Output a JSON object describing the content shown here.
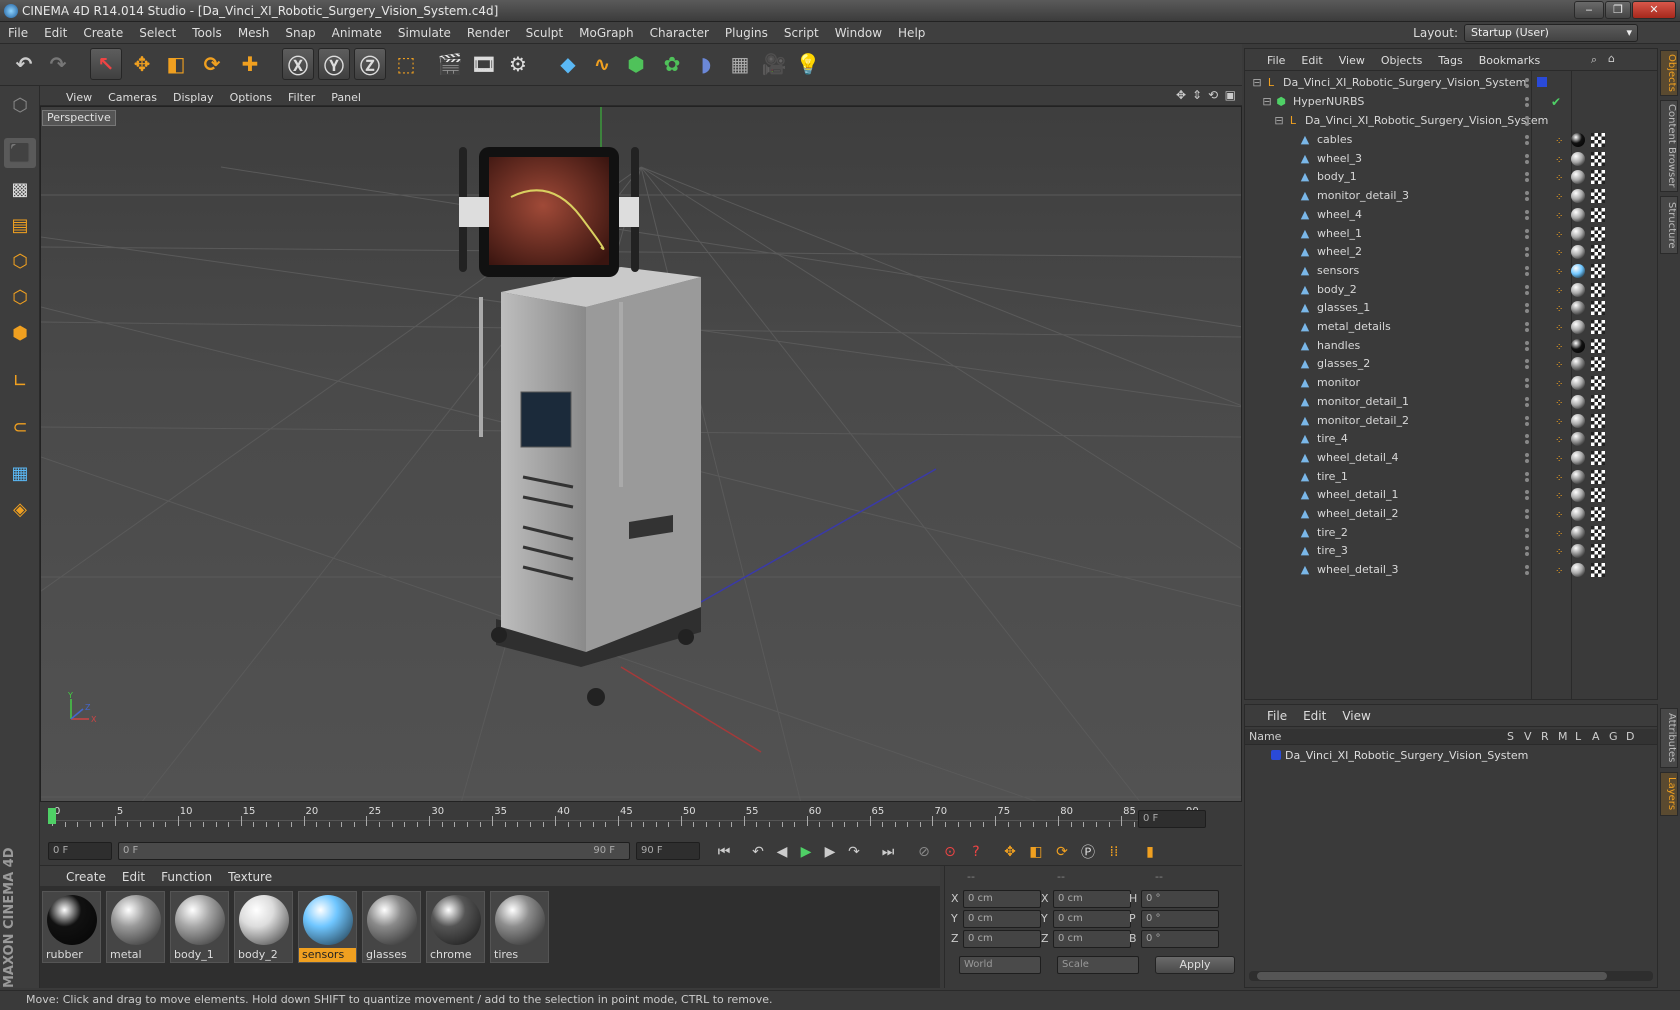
{
  "window": {
    "title": "CINEMA 4D R14.014 Studio - [Da_Vinci_XI_Robotic_Surgery_Vision_System.c4d]"
  },
  "menubar": {
    "items": [
      "File",
      "Edit",
      "Create",
      "Select",
      "Tools",
      "Mesh",
      "Snap",
      "Animate",
      "Simulate",
      "Render",
      "Sculpt",
      "MoGraph",
      "Character",
      "Plugins",
      "Script",
      "Window",
      "Help"
    ],
    "layout_label": "Layout:",
    "layout_value": "Startup (User)"
  },
  "viewport": {
    "menu": [
      "View",
      "Cameras",
      "Display",
      "Options",
      "Filter",
      "Panel"
    ],
    "label": "Perspective"
  },
  "timeline": {
    "ticks": [
      "0",
      "5",
      "10",
      "15",
      "20",
      "25",
      "30",
      "35",
      "40",
      "45",
      "50",
      "55",
      "60",
      "65",
      "70",
      "75",
      "80",
      "85",
      "90"
    ],
    "current_frame": "0 F",
    "start_field": "0 F",
    "range_start": "0 F",
    "range_end": "90 F",
    "end_field": "90 F"
  },
  "materials": {
    "menu": [
      "Create",
      "Edit",
      "Function",
      "Texture"
    ],
    "items": [
      {
        "name": "rubber",
        "color": "#111111"
      },
      {
        "name": "metal",
        "color": "#9a9a9a"
      },
      {
        "name": "body_1",
        "color": "#a8a8a8"
      },
      {
        "name": "body_2",
        "color": "#dddddd"
      },
      {
        "name": "sensors",
        "color": "#6fc6ff"
      },
      {
        "name": "glasses",
        "color": "#8a8a8a"
      },
      {
        "name": "chrome",
        "color": "#555555"
      },
      {
        "name": "tires",
        "color": "#8d8d8d"
      }
    ]
  },
  "coords": {
    "headers": [
      "--",
      "--",
      "--"
    ],
    "rows": [
      {
        "a": "X",
        "av": "0 cm",
        "b": "X",
        "bv": "0 cm",
        "c": "H",
        "cv": "0 °"
      },
      {
        "a": "Y",
        "av": "0 cm",
        "b": "Y",
        "bv": "0 cm",
        "c": "P",
        "cv": "0 °"
      },
      {
        "a": "Z",
        "av": "0 cm",
        "b": "Z",
        "bv": "0 cm",
        "c": "B",
        "cv": "0 °"
      }
    ],
    "space": "World",
    "mode": "Scale",
    "apply": "Apply"
  },
  "objects": {
    "menu": [
      "File",
      "Edit",
      "View",
      "Objects",
      "Tags",
      "Bookmarks"
    ],
    "root": "Da_Vinci_XI_Robotic_Surgery_Vision_System",
    "hypernurbs": "HyperNURBS",
    "group": "Da_Vinci_XI_Robotic_Surgery_Vision_System",
    "children": [
      "cables",
      "wheel_3",
      "body_1",
      "monitor_detail_3",
      "wheel_4",
      "wheel_1",
      "wheel_2",
      "sensors",
      "body_2",
      "glasses_1",
      "metal_details",
      "handles",
      "glasses_2",
      "monitor",
      "monitor_detail_1",
      "monitor_detail_2",
      "tire_4",
      "wheel_detail_4",
      "tire_1",
      "wheel_detail_1",
      "wheel_detail_2",
      "tire_2",
      "tire_3",
      "wheel_detail_3"
    ]
  },
  "layers": {
    "menu": [
      "File",
      "Edit",
      "View"
    ],
    "col_name": "Name",
    "cols": [
      "S",
      "V",
      "R",
      "M",
      "L",
      "A",
      "G",
      "D"
    ],
    "row": "Da_Vinci_XI_Robotic_Surgery_Vision_System"
  },
  "side_tabs": [
    "Objects",
    "Content Browser",
    "Structure",
    "Attributes",
    "Layers"
  ],
  "status": "Move: Click and drag to move elements. Hold down SHIFT to quantize movement / add to the selection in point mode, CTRL to remove.",
  "brand": "MAXON CINEMA 4D"
}
